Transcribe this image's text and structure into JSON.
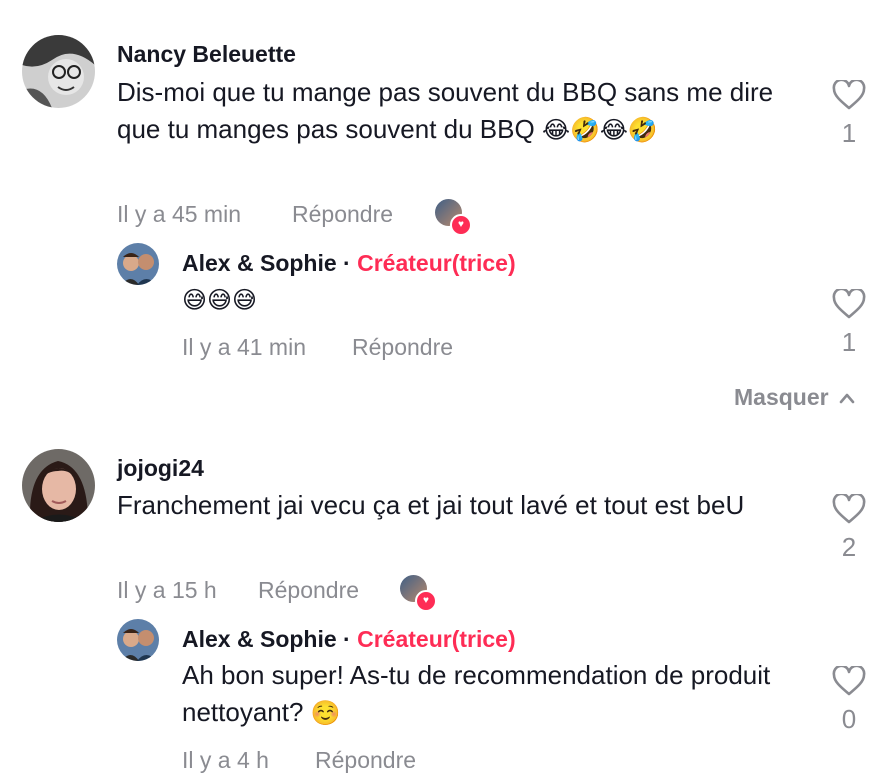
{
  "comments": [
    {
      "username": "Nancy Beleuette",
      "text": "Dis-moi que tu mange pas souvent du BBQ sans me dire que tu manges pas souvent du BBQ",
      "emojis": "😂🤣😂🤣",
      "time": "Il y a 45 min",
      "reply_label": "Répondre",
      "likes": "1",
      "reply": {
        "username": "Alex & Sophie",
        "separator": " · ",
        "badge": "Créateur(trice)",
        "text": "",
        "emojis": "😅😅😅",
        "time": "Il y a 41 min",
        "reply_label": "Répondre",
        "likes": "1"
      }
    },
    {
      "username": "jojogi24",
      "text": "Franchement jai vecu ça et jai tout lavé et tout est beU",
      "time": "Il y a 15 h",
      "reply_label": "Répondre",
      "likes": "2",
      "reply": {
        "username": "Alex & Sophie",
        "separator": " · ",
        "badge": "Créateur(trice)",
        "text": "Ah bon super! As-tu de recommendation de produit nettoyant?",
        "emojis": "☺️",
        "time": "Il y a 4 h",
        "reply_label": "Répondre",
        "likes": "0"
      }
    }
  ],
  "hide_label": "Masquer",
  "colors": {
    "creator": "#fe2c55",
    "meta": "#8a8b91",
    "text": "#161823"
  }
}
